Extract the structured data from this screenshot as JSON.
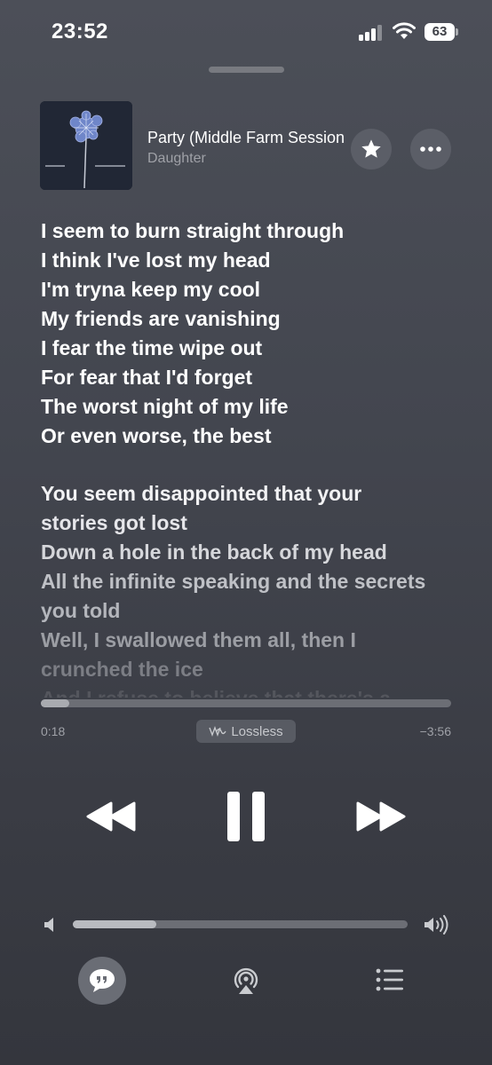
{
  "status": {
    "time": "23:52",
    "battery": "63"
  },
  "track": {
    "title": "Party (Middle Farm Session)",
    "artist": "Daughter"
  },
  "lyrics": {
    "lines": [
      {
        "text": "I seem to burn straight through",
        "color": "#ffffff"
      },
      {
        "text": "I think I've lost my head",
        "color": "#ffffff"
      },
      {
        "text": "I'm tryna keep my cool",
        "color": "#ffffff"
      },
      {
        "text": "My friends are vanishing",
        "color": "#ffffff"
      },
      {
        "text": "I fear the time wipe out",
        "color": "#ffffff"
      },
      {
        "text": "For fear that I'd forget",
        "color": "#ffffff"
      },
      {
        "text": "The worst night of my life",
        "color": "#ffffff"
      },
      {
        "text": "Or even worse, the best",
        "color": "#ffffff"
      },
      {
        "gap": true
      },
      {
        "text": "You seem disappointed that your",
        "color": "#f2f2f4"
      },
      {
        "text": "stories got lost",
        "color": "#e6e6ea"
      },
      {
        "text": "Down a hole in the back of my head",
        "color": "#d6d7db"
      },
      {
        "text": "All the infinite speaking and the secrets",
        "color": "#bfc1c6"
      },
      {
        "text": "you told",
        "color": "#b4b6bc"
      },
      {
        "text": "Well, I swallowed them all, then I",
        "color": "#9c9ea4"
      },
      {
        "text": "crunched the ice",
        "color": "#7c7e85"
      },
      {
        "text": "And I refuse to believe that there's a",
        "color": "#54565d"
      }
    ]
  },
  "playback": {
    "elapsed": "0:18",
    "remaining": "−3:56",
    "progress": 0.07,
    "quality": "Lossless",
    "state": "playing"
  },
  "volume": {
    "level": 0.25
  },
  "icons": {
    "favorite": "star-icon",
    "more": "ellipsis-icon",
    "rewind": "rewind-icon",
    "pause": "pause-icon",
    "forward": "fast-forward-icon",
    "lyrics": "lyrics-quote-icon",
    "airplay": "airplay-icon",
    "queue": "queue-list-icon"
  },
  "colors": {
    "background": "#43464f",
    "secondary_text": "#9fa1a7",
    "track": "#6c6e75"
  }
}
